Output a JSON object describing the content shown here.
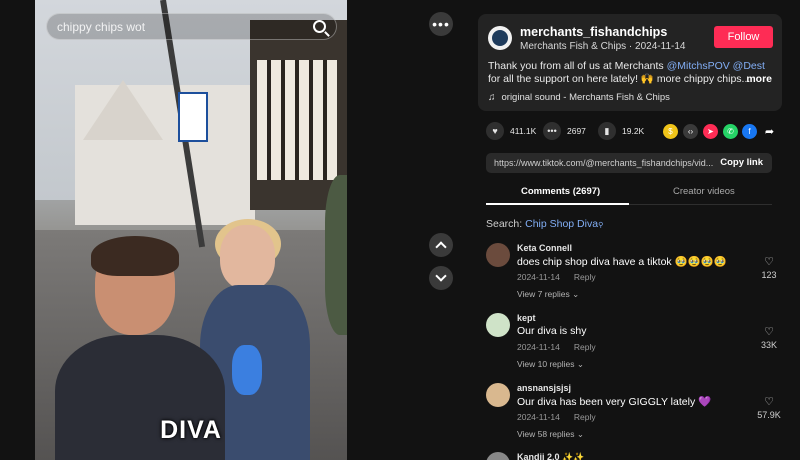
{
  "video": {
    "search_text": "chippy chips wot",
    "caption": "DIVA"
  },
  "post": {
    "author": "merchants_fishandchips",
    "display_name": "Merchants Fish & Chips",
    "date": "2024-11-14",
    "follow_label": "Follow",
    "description_prefix": "Thank you from all of us at Merchants ",
    "mention1": "@MitchsPOV",
    "mention2": "@Dest",
    "description_suffix": " for all the support on here lately! 🙌 more chippy chips...",
    "more_label": "more",
    "sound": "original sound - Merchants Fish & Chips"
  },
  "actions": {
    "likes": "411.1K",
    "comments": "2697",
    "saves": "19.2K"
  },
  "share_link": {
    "url": "https://www.tiktok.com/@merchants_fishandchips/vid...",
    "copy_label": "Copy link"
  },
  "tabs": {
    "comments": "Comments (2697)",
    "creator": "Creator videos"
  },
  "search": {
    "prefix": "Search: ",
    "term": "Chip Shop Diva"
  },
  "comments": [
    {
      "user": "Keta Connell",
      "text": "does chip shop diva have a tiktok 🥹🥹🥹🥹",
      "date": "2024-11-14",
      "reply": "Reply",
      "replies": "View 7 replies",
      "likes": "123",
      "avatar_color": "#6b4b3d"
    },
    {
      "user": "kept",
      "text": "Our diva is shy",
      "date": "2024-11-14",
      "reply": "Reply",
      "replies": "View 10 replies",
      "likes": "33K",
      "avatar_color": "#cfe3c8"
    },
    {
      "user": "ansnansjsjsj",
      "text": "Our diva has been very GIGGLY lately 💜",
      "date": "2024-11-14",
      "reply": "Reply",
      "replies": "View 58 replies",
      "likes": "57.9K",
      "avatar_color": "#d9b88f"
    },
    {
      "user": "Kandii 2.0 ✨✨",
      "avatar_color": "#888888"
    }
  ],
  "colors": {
    "accent": "#fe2c55",
    "mention": "#82aef5",
    "background": "#121212"
  }
}
